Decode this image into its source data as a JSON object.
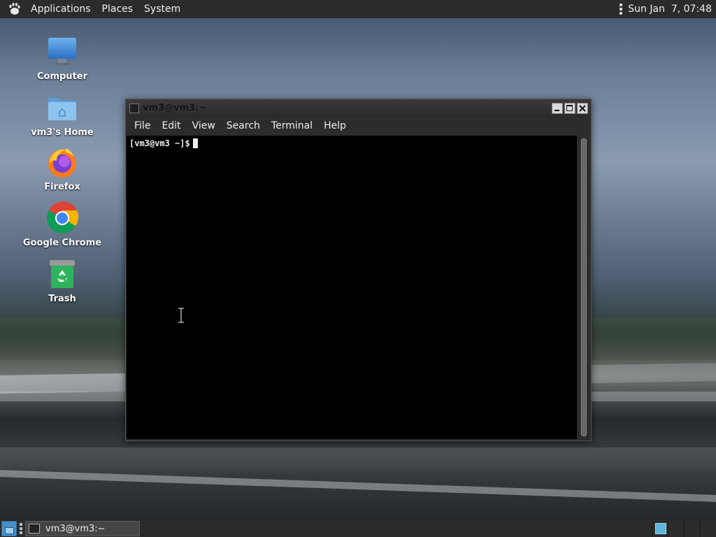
{
  "top_panel": {
    "menus": [
      "Applications",
      "Places",
      "System"
    ],
    "clock": "Sun Jan  7, 07:48"
  },
  "desktop_icons": [
    {
      "label": "Computer",
      "icon": "computer-icon"
    },
    {
      "label": "vm3's Home",
      "icon": "home-folder-icon"
    },
    {
      "label": "Firefox",
      "icon": "firefox-icon"
    },
    {
      "label": "Google Chrome",
      "icon": "chrome-icon"
    },
    {
      "label": "Trash",
      "icon": "trash-icon"
    }
  ],
  "window": {
    "title": "vm3@vm3:~",
    "menus": [
      "File",
      "Edit",
      "View",
      "Search",
      "Terminal",
      "Help"
    ],
    "prompt": "[vm3@vm3 ~]$"
  },
  "taskbar": {
    "task_label": "vm3@vm3:~"
  },
  "colors": {
    "panel": "#2b2b2b",
    "terminal_bg": "#000000",
    "workspace_active": "#5fb4d9"
  }
}
